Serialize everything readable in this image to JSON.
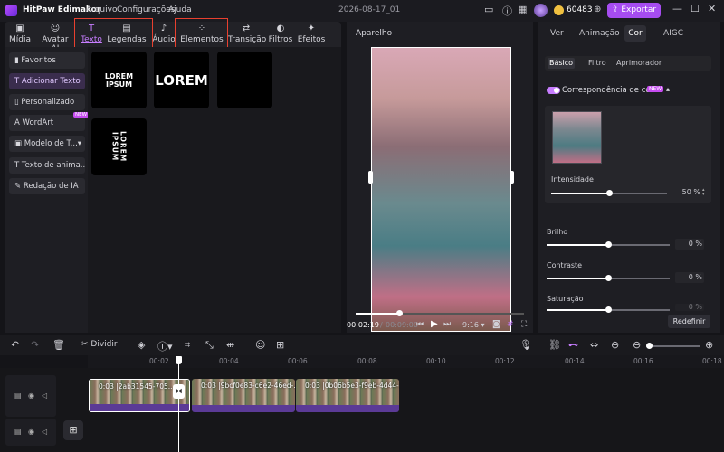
{
  "app": {
    "title": "HitPaw Edimakor",
    "menu": [
      "Arquivo",
      "Configurações",
      "Ajuda"
    ],
    "project_name": "2026-08-17_01",
    "credits": "60483",
    "export_label": "Exportar"
  },
  "toolbar": {
    "tabs": [
      "Mídia",
      "Avatar AI",
      "Texto",
      "Legendas",
      "Áudio",
      "Elementos",
      "Transição",
      "Filtros",
      "Efeitos"
    ],
    "highlight_color": "#e8402f"
  },
  "sidebar": {
    "items": [
      "Favoritos",
      "Adicionar Texto",
      "Personalizado",
      "WordArt",
      "Modelo de T...",
      "Texto de anima...",
      "Redação de IA"
    ],
    "new_badge": "NEW"
  },
  "text_tiles": [
    "LOREM IPSUM",
    "LOREM",
    "LOREM IPSUM"
  ],
  "preview": {
    "title": "Aparelho",
    "current_time": "00:02:19",
    "total_time": "00:09:00",
    "aspect": "9:16",
    "progress": 0.26
  },
  "right_panel": {
    "tabs": [
      "Ver",
      "Animação",
      "Cor",
      "AIGC"
    ],
    "subtabs": [
      "Básico",
      "Filtro",
      "Aprimorador"
    ],
    "color_match_label": "Correspondência de cores",
    "new_badge": "NEW",
    "intensity_label": "Intensidade",
    "intensity_value": "50",
    "intensity_unit": "%",
    "adjustments": [
      {
        "label": "Brilho",
        "value": "0",
        "unit": "%"
      },
      {
        "label": "Contraste",
        "value": "0",
        "unit": "%"
      },
      {
        "label": "Saturação",
        "value": "0",
        "unit": "%"
      }
    ],
    "reset_label": "Redefinir"
  },
  "timeline": {
    "split_label": "Dividir",
    "ruler": [
      "00:02",
      "00:04",
      "00:06",
      "00:08",
      "00:10",
      "00:12",
      "00:14",
      "00:16",
      "00:18"
    ],
    "clips": [
      {
        "label": "0:03 |2ab31545-705..."
      },
      {
        "label": "0:03 |9bcf0e83-c6e2-46ed-..."
      },
      {
        "label": "0:03 |0b06b5e3-f9eb-4d44-..."
      }
    ]
  },
  "colors": {
    "accent": "#c77dff",
    "export_bg": "#a64cf0",
    "clip_bottom": "#5b3a96"
  }
}
